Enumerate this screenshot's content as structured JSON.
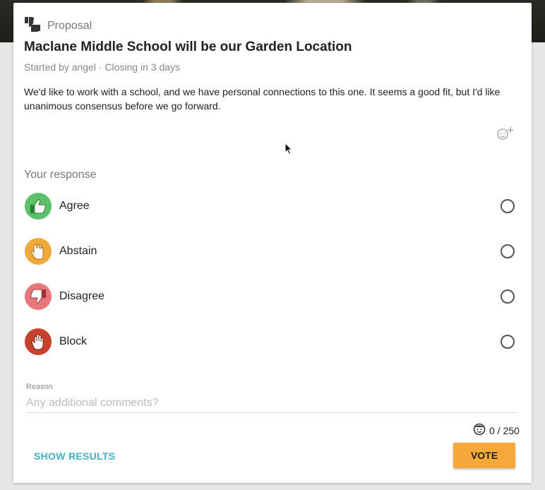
{
  "poll": {
    "kind": "Proposal",
    "title": "Maclane Middle School will be our Garden Location",
    "meta": "Started by angel · Closing in 3 days",
    "description": "We'd like to work with a school, and we have personal connections to this one. It seems a good fit, but I'd like unanimous consensus before we go forward."
  },
  "response": {
    "label": "Your response",
    "options": [
      {
        "label": "Agree",
        "icon": "thumbs-up-icon",
        "color": "#5bc26a"
      },
      {
        "label": "Abstain",
        "icon": "raised-hand-icon",
        "color": "#f0a93a"
      },
      {
        "label": "Disagree",
        "icon": "thumbs-down-icon",
        "color": "#e9767a"
      },
      {
        "label": "Block",
        "icon": "stop-hand-icon",
        "color": "#c8412d"
      }
    ]
  },
  "reason": {
    "label": "Reason",
    "placeholder": "Any additional comments?",
    "counter": "0 / 250"
  },
  "actions": {
    "show_results": "SHOW RESULTS",
    "vote": "VOTE"
  }
}
